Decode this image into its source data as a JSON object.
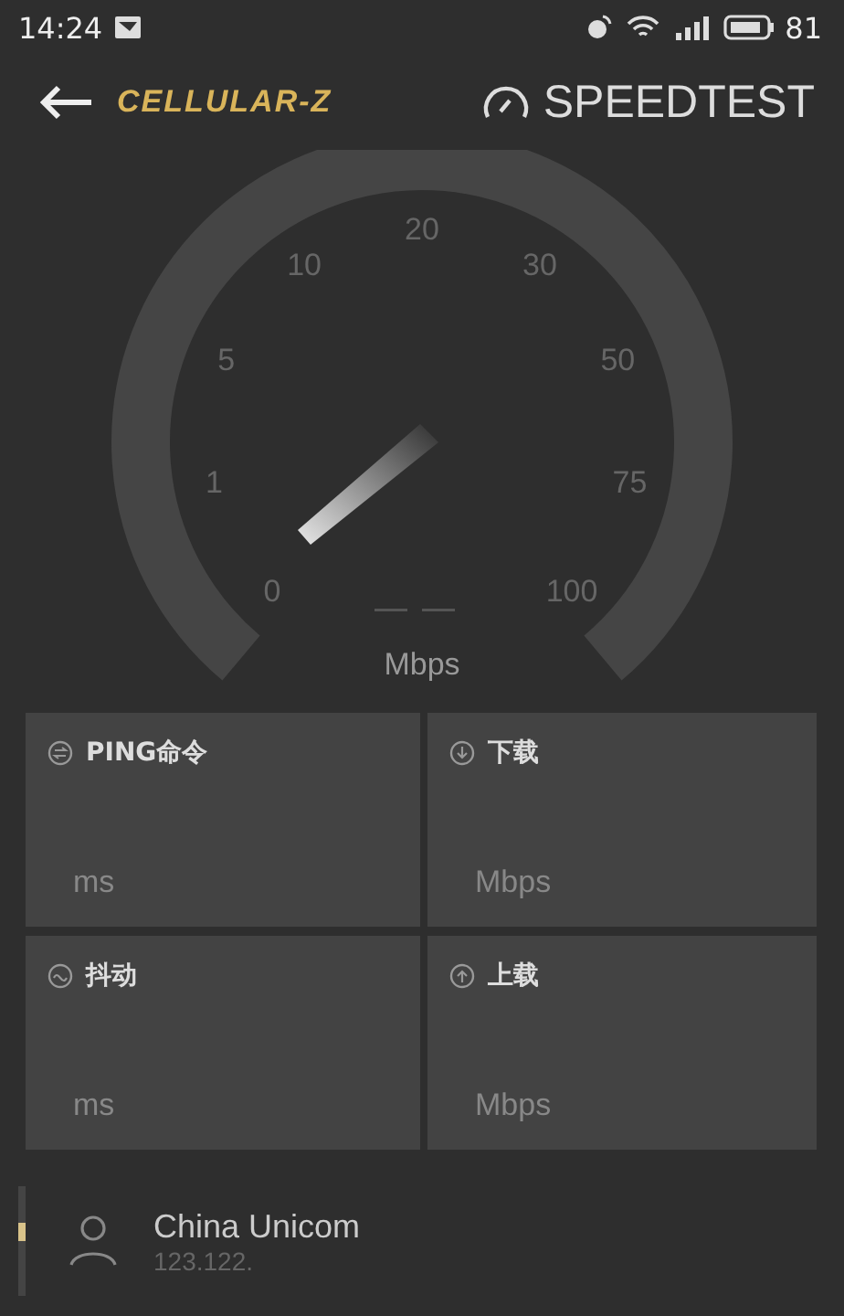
{
  "status_bar": {
    "time": "14:24",
    "battery": "81"
  },
  "header": {
    "logo": "CELLULAR-Z",
    "brand": "SPEEDTEST"
  },
  "gauge": {
    "ticks": [
      "0",
      "1",
      "5",
      "10",
      "20",
      "30",
      "50",
      "75",
      "100"
    ],
    "unit": "Mbps"
  },
  "metrics": [
    {
      "kind": "ping",
      "label": "PING命令",
      "unit": "ms"
    },
    {
      "kind": "download",
      "label": "下载",
      "unit": "Mbps"
    },
    {
      "kind": "jitter",
      "label": "抖动",
      "unit": "ms"
    },
    {
      "kind": "upload",
      "label": "上载",
      "unit": "Mbps"
    }
  ],
  "carrier": {
    "name": "China Unicom",
    "ip": "123.122."
  }
}
